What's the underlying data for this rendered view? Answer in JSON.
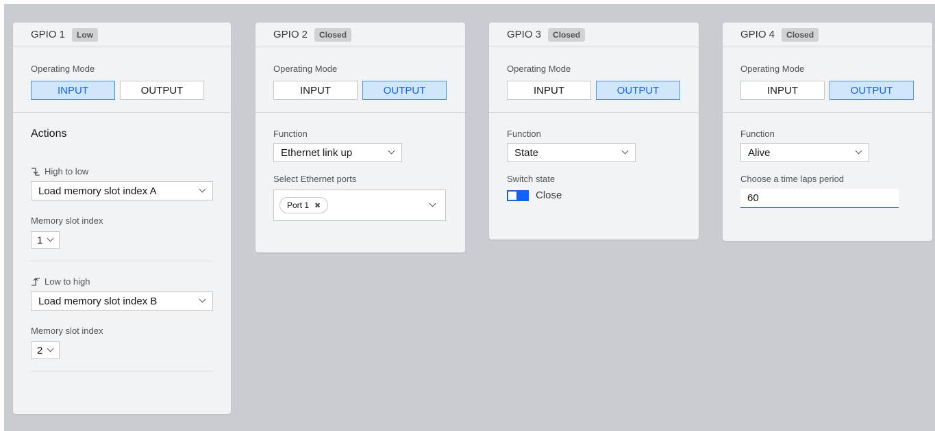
{
  "panels": [
    {
      "title": "GPIO 1",
      "badge": "Low",
      "operating_mode_label": "Operating Mode",
      "mode_input": "INPUT",
      "mode_output": "OUTPUT",
      "active_mode": "INPUT",
      "actions_heading": "Actions",
      "high_to_low": {
        "label": "High to low",
        "action": "Load memory slot index A",
        "slot_label": "Memory slot index",
        "slot_value": "1"
      },
      "low_to_high": {
        "label": "Low to high",
        "action": "Load memory slot index B",
        "slot_label": "Memory slot index",
        "slot_value": "2"
      }
    },
    {
      "title": "GPIO 2",
      "badge": "Closed",
      "operating_mode_label": "Operating Mode",
      "mode_input": "INPUT",
      "mode_output": "OUTPUT",
      "active_mode": "OUTPUT",
      "function_label": "Function",
      "function_value": "Ethernet link up",
      "ports_label": "Select Ethernet ports",
      "ports_tags": [
        "Port 1"
      ]
    },
    {
      "title": "GPIO 3",
      "badge": "Closed",
      "operating_mode_label": "Operating Mode",
      "mode_input": "INPUT",
      "mode_output": "OUTPUT",
      "active_mode": "OUTPUT",
      "function_label": "Function",
      "function_value": "State",
      "switch_label": "Switch state",
      "switch_text": "Close",
      "switch_on": true
    },
    {
      "title": "GPIO 4",
      "badge": "Closed",
      "operating_mode_label": "Operating Mode",
      "mode_input": "INPUT",
      "mode_output": "OUTPUT",
      "active_mode": "OUTPUT",
      "function_label": "Function",
      "function_value": "Alive",
      "period_label": "Choose a time laps period",
      "period_value": "60"
    }
  ],
  "colors": {
    "background": "#c9ccd1",
    "panel": "#f2f3f5",
    "active_button_fill": "#d0e6fb",
    "active_button_text": "#0f62fe",
    "badge_fill": "#d0d2d6"
  }
}
